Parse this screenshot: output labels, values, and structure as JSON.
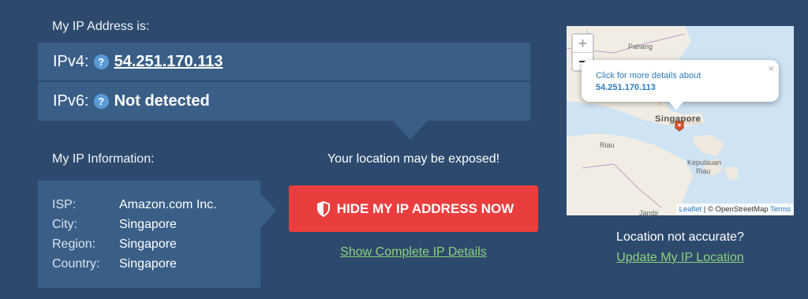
{
  "ip_section": {
    "heading": "My IP Address is:",
    "ipv4_label": "IPv4:",
    "ipv4_value": "54.251.170.113",
    "ipv6_label": "IPv6:",
    "ipv6_value": "Not detected",
    "help_glyph": "?"
  },
  "info_section": {
    "heading": "My IP Information:",
    "rows": [
      {
        "key": "ISP:",
        "value": "Amazon.com Inc."
      },
      {
        "key": "City:",
        "value": "Singapore"
      },
      {
        "key": "Region:",
        "value": "Singapore"
      },
      {
        "key": "Country:",
        "value": "Singapore"
      }
    ]
  },
  "action": {
    "warning": "Your location may be exposed!",
    "hide_button": "HIDE MY IP ADDRESS NOW",
    "details_link": "Show Complete IP Details"
  },
  "map": {
    "zoom_in": "+",
    "zoom_out": "−",
    "popup_text": "Click for more details about",
    "popup_ip": "54.251.170.113",
    "popup_close": "×",
    "labels": {
      "pahang": "Pahang",
      "singapore": "Singapore",
      "riau": "Riau",
      "kepulauan_1": "Kepulauan",
      "kepulauan_2": "Riau",
      "jambi": "Jambi"
    },
    "attribution": {
      "leaflet": "Leaflet",
      "sep": " | © OpenStreetMap ",
      "terms": "Terms"
    }
  },
  "location_section": {
    "question": "Location not accurate?",
    "update_link": "Update My IP Location"
  },
  "colors": {
    "background": "#2d4a6e",
    "panel": "#3a5f87",
    "button": "#ea3e3e",
    "link": "#8dd07c"
  }
}
